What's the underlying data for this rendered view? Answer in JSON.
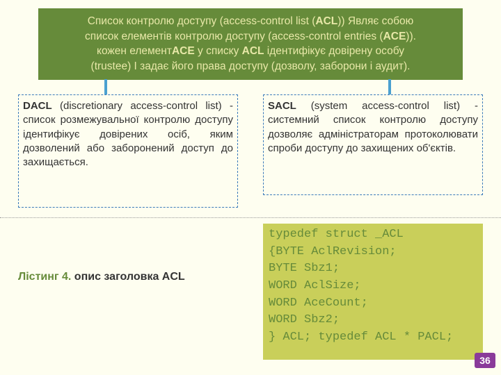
{
  "top": {
    "line1a": "Список контролю доступу (access-control list (",
    "acl": "ACL",
    "line1b": ")) Являє собою",
    "line2a": "список елементів контролю доступу (access-control entries (",
    "ace": "ACE",
    "line2b": ")).",
    "line3a": "кожен елемент",
    "line3b": " у списку ",
    "line3c": " ідентифікує довірену особу",
    "line4": "(trustee) I задає його права доступу (дозволу, заборони і аудит)."
  },
  "dacl": {
    "lead": "DACL",
    "body": " (discretionary access-control list) - список розмежувальної контролю доступу ідентифікує довірених осіб, яким дозволений або заборонений доступ до захищається."
  },
  "sacl": {
    "lead": "SACL",
    "body": " (system access-control list) - системний список контролю доступу дозволяє адміністраторам протоколювати спроби доступу до захищених об'єктів."
  },
  "listing": {
    "num": "Лістинг 4.",
    "txt": " опис заголовка ACL"
  },
  "code": "typedef struct _ACL\n{BYTE AclRevision;\nBYTE Sbz1;\nWORD AclSize;\nWORD AceCount;\nWORD Sbz2;\n} ACL; typedef ACL * PACL;",
  "page": "36"
}
